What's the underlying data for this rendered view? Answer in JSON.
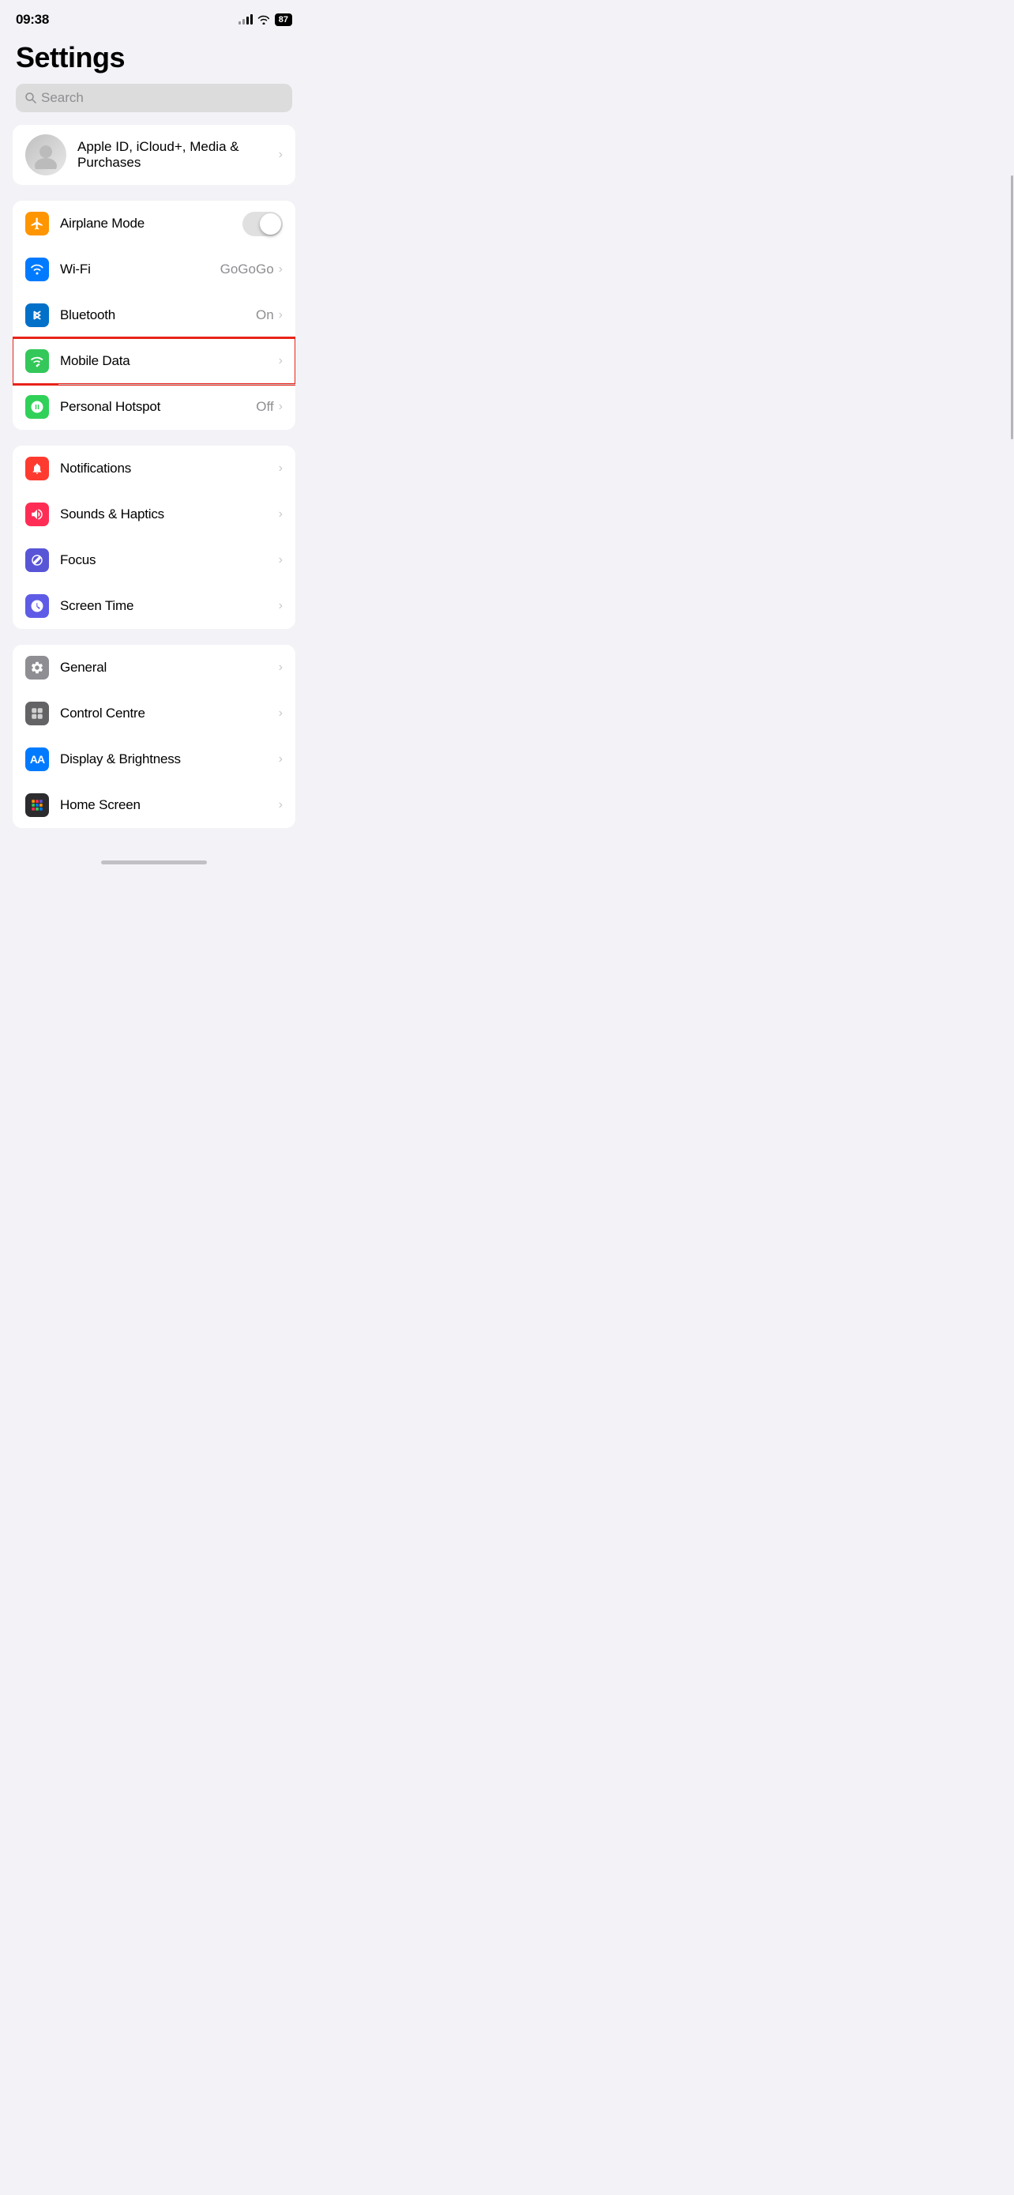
{
  "statusBar": {
    "time": "09:38",
    "battery": "87",
    "wifiSymbol": "wifi"
  },
  "pageTitle": "Settings",
  "searchBar": {
    "placeholder": "Search"
  },
  "appleIdRow": {
    "label": "Apple ID, iCloud+, Media & Purchases"
  },
  "connectivityGroup": [
    {
      "id": "airplane-mode",
      "label": "Airplane Mode",
      "iconBg": "bg-orange",
      "iconType": "airplane",
      "valueType": "toggle",
      "toggleOn": false,
      "highlighted": false
    },
    {
      "id": "wifi",
      "label": "Wi-Fi",
      "iconBg": "bg-blue",
      "iconType": "wifi",
      "valueType": "chevron",
      "value": "GoGoGo",
      "highlighted": false
    },
    {
      "id": "bluetooth",
      "label": "Bluetooth",
      "iconBg": "bg-blue-dark",
      "iconType": "bluetooth",
      "valueType": "chevron",
      "value": "On",
      "highlighted": false
    },
    {
      "id": "mobile-data",
      "label": "Mobile Data",
      "iconBg": "bg-green-signal",
      "iconType": "signal",
      "valueType": "chevron",
      "value": "",
      "highlighted": true
    },
    {
      "id": "personal-hotspot",
      "label": "Personal Hotspot",
      "iconBg": "bg-green-hotspot",
      "iconType": "hotspot",
      "valueType": "chevron",
      "value": "Off",
      "highlighted": false
    }
  ],
  "notificationsGroup": [
    {
      "id": "notifications",
      "label": "Notifications",
      "iconBg": "bg-red",
      "iconType": "bell",
      "valueType": "chevron",
      "value": ""
    },
    {
      "id": "sounds-haptics",
      "label": "Sounds & Haptics",
      "iconBg": "bg-pink",
      "iconType": "sound",
      "valueType": "chevron",
      "value": ""
    },
    {
      "id": "focus",
      "label": "Focus",
      "iconBg": "bg-purple",
      "iconType": "moon",
      "valueType": "chevron",
      "value": ""
    },
    {
      "id": "screen-time",
      "label": "Screen Time",
      "iconBg": "bg-indigo",
      "iconType": "hourglass",
      "valueType": "chevron",
      "value": ""
    }
  ],
  "generalGroup": [
    {
      "id": "general",
      "label": "General",
      "iconBg": "bg-gray",
      "iconType": "gear",
      "valueType": "chevron",
      "value": ""
    },
    {
      "id": "control-centre",
      "label": "Control Centre",
      "iconBg": "bg-gray-dark",
      "iconType": "control",
      "valueType": "chevron",
      "value": ""
    },
    {
      "id": "display-brightness",
      "label": "Display & Brightness",
      "iconBg": "bg-blue-aa",
      "iconType": "aa",
      "valueType": "chevron",
      "value": ""
    },
    {
      "id": "home-screen",
      "label": "Home Screen",
      "iconBg": "bg-blue-home",
      "iconType": "grid",
      "valueType": "chevron",
      "value": ""
    }
  ],
  "labels": {
    "chevron": "›",
    "off": "Off",
    "on": "On"
  }
}
